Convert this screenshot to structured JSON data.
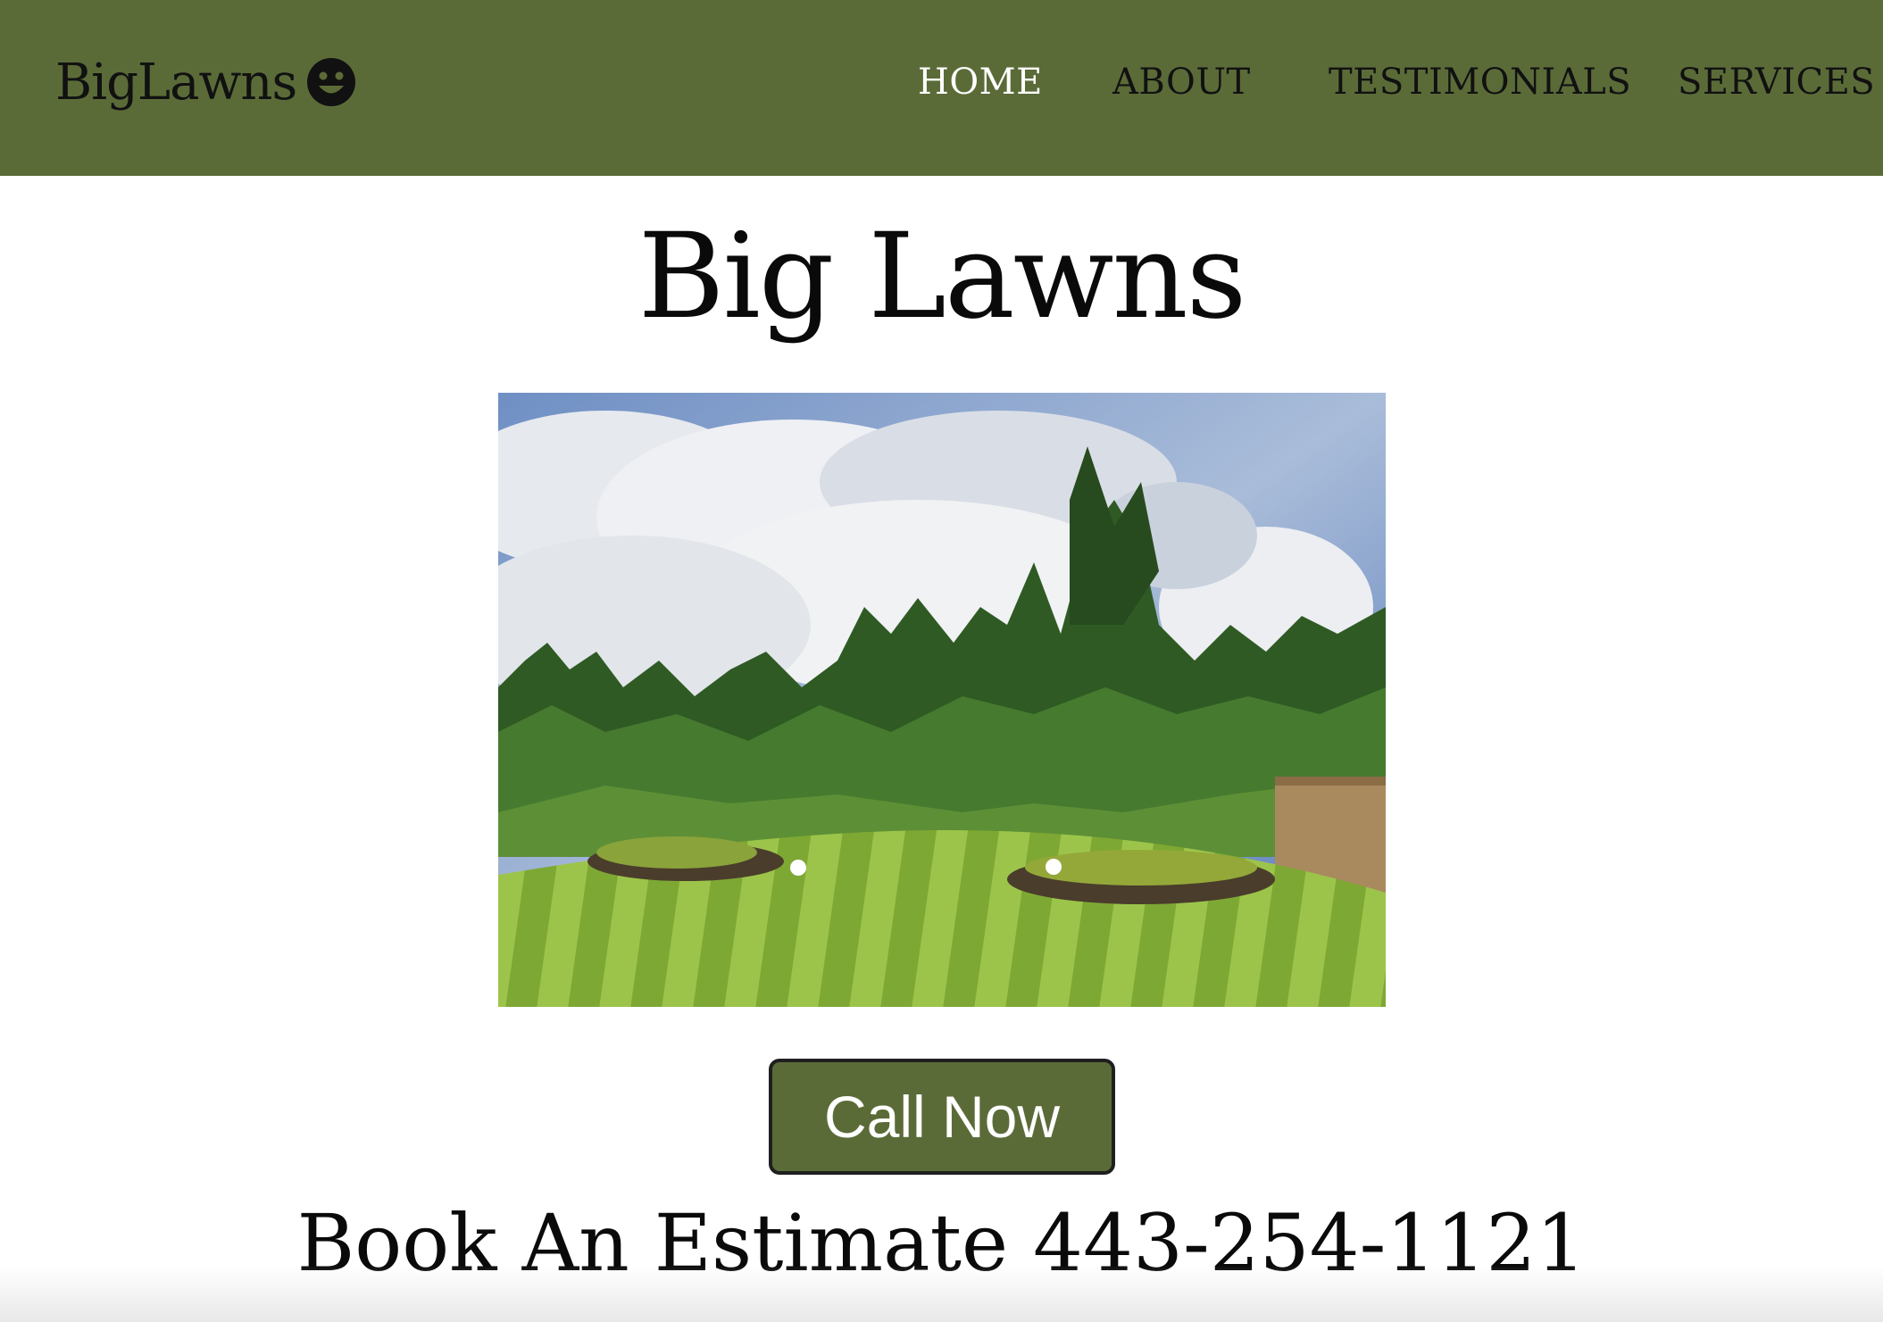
{
  "header": {
    "brand": "BigLawns",
    "brand_icon": "smiley-face-icon",
    "nav": [
      {
        "label": "HOME",
        "active": true
      },
      {
        "label": "ABOUT",
        "active": false
      },
      {
        "label": "TESTIMONIALS",
        "active": false
      },
      {
        "label": "SERVICES",
        "active": false
      }
    ]
  },
  "main": {
    "title": "Big Lawns",
    "cta_label": "Call Now",
    "estimate_text": "Book An Estimate 443-254-1121"
  },
  "colors": {
    "header_bg": "#5b6b38",
    "button_bg": "#5b6b38",
    "nav_active": "#ffffff",
    "nav_text": "#111111"
  }
}
